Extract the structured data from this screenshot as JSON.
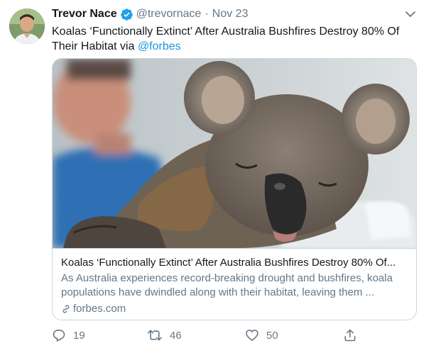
{
  "tweet": {
    "author": {
      "display_name": "Trevor Nace",
      "handle": "@trevornace",
      "verified_icon": "verified-badge-icon"
    },
    "separator": "·",
    "date": "Nov 23",
    "text": {
      "line1": "Koalas ‘Functionally Extinct’ After Australia Bushfires Destroy 80% Of",
      "line2": "Their Habitat via ",
      "mention": "@forbes"
    },
    "card": {
      "title": "Koalas ‘Functionally Extinct’ After Australia Bushfires Destroy 80% Of...",
      "description": "As Australia experiences record-breaking drought and bushfires, koala populations have dwindled along with their habitat, leaving them ...",
      "domain": "forbes.com"
    },
    "actions": {
      "reply_count": "19",
      "retweet_count": "46",
      "like_count": "50"
    }
  },
  "colors": {
    "link": "#1b95e0",
    "secondary_text": "#657786",
    "border": "#ccd6dd",
    "verified": "#1da1f2"
  }
}
